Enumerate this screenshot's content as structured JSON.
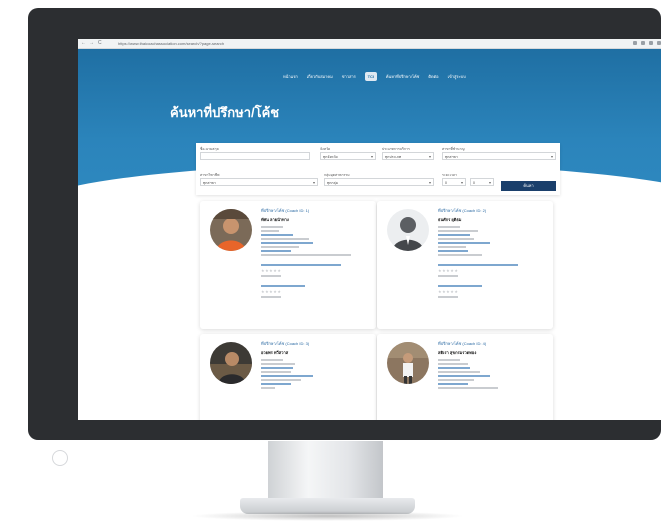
{
  "browser": {
    "nav_back": "←",
    "nav_forward": "→",
    "nav_reload": "C",
    "url": "https://www.thaicoachassociation.com/search/?page-search"
  },
  "site": {
    "logo_text": "TCI",
    "nav_items": [
      "หน้าแรก",
      "เกี่ยวกับสมาคม",
      "ข่าวสาร",
      "ค้นหาที่ปรึกษา/โค้ช",
      "ติดต่อ",
      "เข้าสู่ระบบ"
    ],
    "page_title": "ค้นหาที่ปรึกษา/โค้ช"
  },
  "search": {
    "labels": [
      "ชื่อ-นามสกุล",
      "จังหวัด",
      "ประเภทการบริการ",
      "สาขาที่ชำนาญ",
      "สาขาวิชาชีพ",
      "กลุ่มอุตสาหกรรม",
      "ระยะเวลา"
    ],
    "values": [
      "",
      "ทุกจังหวัด",
      "ทุกประเภท",
      "ทุกสาขา",
      "ทุกสาขา",
      "ทุกกลุ่ม",
      "0"
    ],
    "search_button": "ค้นหา"
  },
  "cards": [
    {
      "id_label": "ที่ปรึกษา/โค้ช (Coach ID: 1)",
      "name": "ทัศน ลายนำทาง"
    },
    {
      "id_label": "ที่ปรึกษา/โค้ช (Coach ID: 2)",
      "name": "ธนศักร ยุติธม"
    },
    {
      "id_label": "ที่ปรึกษา/โค้ช (Coach ID: 3)",
      "name": "อวยพร ทวีสวาส"
    },
    {
      "id_label": "ที่ปรึกษา/โค้ช (Coach ID: 4)",
      "name": "สติเรา สุขกรมรวดทอง"
    }
  ],
  "colors": {
    "hero": "#2b84bb",
    "button": "#1a3f6b",
    "link": "#2b6aa3"
  }
}
